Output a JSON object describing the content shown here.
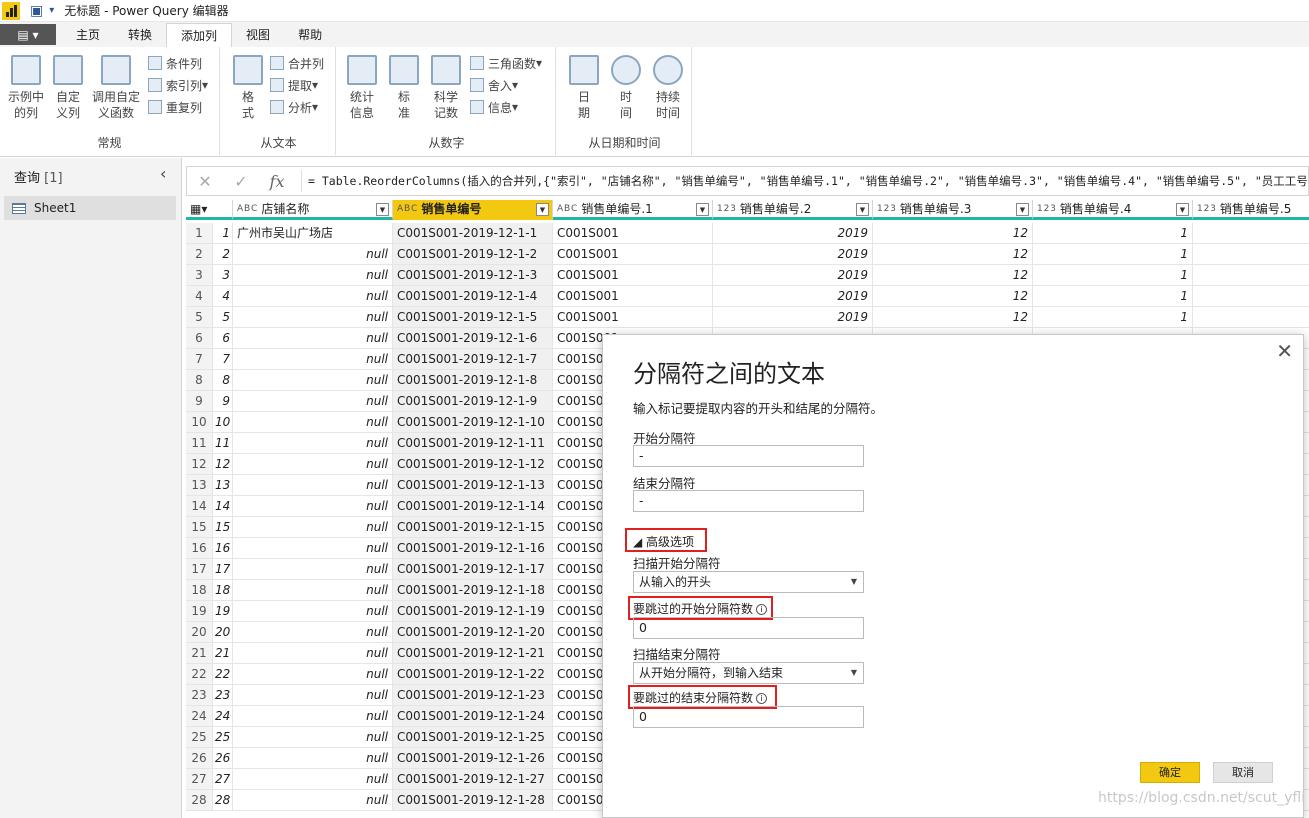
{
  "titlebar": {
    "title": "无标题 - Power Query 编辑器"
  },
  "tabs": [
    "主页",
    "转换",
    "添加列",
    "视图",
    "帮助"
  ],
  "active_tab": "添加列",
  "ribbon": {
    "general": {
      "group": "常规",
      "example_col": "示例中\n的列",
      "custom_col": "自定\n义列",
      "invoke_fn": "调用自定\n义函数",
      "conditional": "条件列",
      "index": "索引列",
      "duplicate": "重复列"
    },
    "from_text": {
      "group": "从文本",
      "format": "格\n式",
      "merge": "合并列",
      "extract": "提取",
      "parse": "分析"
    },
    "from_number": {
      "group": "从数字",
      "stats": "统计\n信息",
      "standard": "标\n准",
      "scientific": "科学\n记数",
      "trig": "三角函数",
      "rounding": "舍入",
      "info": "信息"
    },
    "from_datetime": {
      "group": "从日期和时间",
      "date": "日\n期",
      "time": "时\n间",
      "duration": "持续\n时间"
    }
  },
  "queries": {
    "header": "查询",
    "count": "[1]",
    "items": [
      "Sheet1"
    ]
  },
  "formula": "= Table.ReorderColumns(插入的合并列,{\"索引\", \"店铺名称\", \"销售单编号\", \"销售单编号.1\", \"销售单编号.2\", \"销售单编号.3\", \"销售单编号.4\", \"销售单编号.5\", \"员工工号",
  "columns": [
    {
      "type": "ABC",
      "name": "店铺名称"
    },
    {
      "type": "ABC",
      "name": "销售单编号"
    },
    {
      "type": "ABC",
      "name": "销售单编号.1"
    },
    {
      "type": "123",
      "name": "销售单编号.2"
    },
    {
      "type": "123",
      "name": "销售单编号.3"
    },
    {
      "type": "123",
      "name": "销售单编号.4"
    },
    {
      "type": "123",
      "name": "销售单编号.5"
    }
  ],
  "first_row_store": "广州市吴山广场店",
  "null_text": "null",
  "order_prefix": "C001S001-2019-12-1-",
  "store_code": "C001S001",
  "year": "2019",
  "month": "12",
  "day": "1",
  "row_count": 28,
  "full_rows": 5,
  "dialog": {
    "title": "分隔符之间的文本",
    "description": "输入标记要提取内容的开头和结尾的分隔符。",
    "start_label": "开始分隔符",
    "start_value": "-",
    "end_label": "结束分隔符",
    "end_value": "-",
    "advanced": "高级选项",
    "scan_start_label": "扫描开始分隔符",
    "scan_start_value": "从输入的开头",
    "skip_start_label": "要跳过的开始分隔符数",
    "skip_start_value": "0",
    "scan_end_label": "扫描结束分隔符",
    "scan_end_value": "从开始分隔符，到输入结束",
    "skip_end_label": "要跳过的结束分隔符数",
    "skip_end_value": "0",
    "ok": "确定",
    "cancel": "取消"
  },
  "watermark": "https://blog.csdn.net/scut_yfli",
  "colors": {
    "accent": "#f2c811",
    "teal": "#1fb5a8",
    "highlight": "#e02020"
  }
}
